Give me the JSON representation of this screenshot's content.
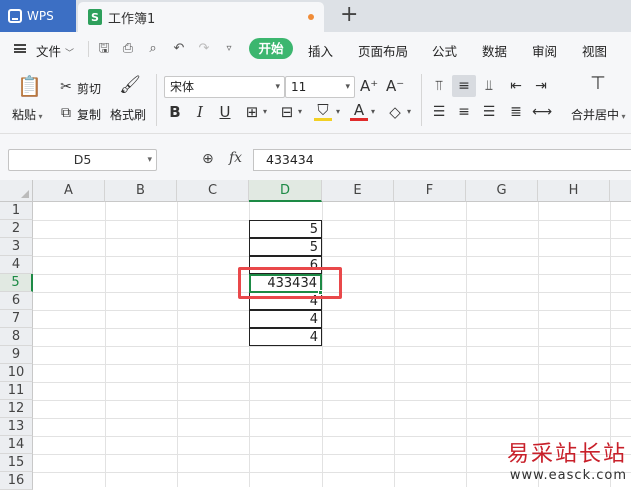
{
  "app": {
    "brand": "WPS",
    "doc_tab": "工作簿1",
    "doc_icon_letter": "S",
    "new_tab": "+"
  },
  "menu": {
    "file": "文件",
    "tabs": [
      "开始",
      "插入",
      "页面布局",
      "公式",
      "数据",
      "审阅",
      "视图"
    ]
  },
  "ribbon": {
    "paste": "粘贴",
    "cut": "剪切",
    "copy": "复制",
    "format_painter": "格式刷",
    "font_name": "宋体",
    "font_size": "11",
    "grow_font": "A⁺",
    "shrink_font": "A⁻",
    "bold": "B",
    "italic": "I",
    "underline": "U",
    "merge_center": "合并居中"
  },
  "formula_bar": {
    "cell_ref": "D5",
    "fx": "fx",
    "value": "433434"
  },
  "grid": {
    "columns": [
      "A",
      "B",
      "C",
      "D",
      "E",
      "F",
      "G",
      "H"
    ],
    "active_column": "D",
    "rows": [
      "1",
      "2",
      "3",
      "4",
      "5",
      "6",
      "7",
      "8",
      "9",
      "10",
      "11",
      "12",
      "13",
      "14",
      "15",
      "16"
    ],
    "active_row": "5",
    "d_column_values": {
      "2": "5",
      "3": "5",
      "4": "6",
      "5": "433434",
      "6": "4",
      "7": "4",
      "8": "4"
    }
  },
  "watermark": {
    "cn": "易采站长站",
    "url": "www.easck.com"
  },
  "colors": {
    "accent_green": "#1d8a45",
    "start_pill": "#3cb66f",
    "wps_blue": "#3c6fc4",
    "highlight_red": "#e9484a"
  }
}
